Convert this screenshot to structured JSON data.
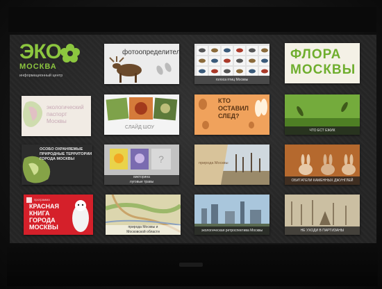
{
  "logo": {
    "main": "ЭКО",
    "city": "МОСКВА",
    "subtitle": "информационный центр"
  },
  "tiles": {
    "opredelitel": {
      "title": "фотоопределитель"
    },
    "birds": {
      "caption": "голоса птиц Москвы"
    },
    "flora": {
      "line1": "ФЛОРА",
      "line2": "МОСКВЫ"
    },
    "passport": {
      "line1": "экологический",
      "line2": "паспорт",
      "line3": "Москвы"
    },
    "slideshow": {
      "caption": "СЛАЙД ШОУ"
    },
    "tracks": {
      "line1": "КТО",
      "line2": "ОСТАВИЛ",
      "line3": "СЛЕД?"
    },
    "hedgehog": {
      "caption": "ЧТО ЕСТ ЕЖИК"
    },
    "protected": {
      "line1": "ОСОБО ОХРАНЯЕМЫЕ",
      "line2": "ПРИРОДНЫЕ ТЕРРИТОРИИ",
      "line3": "ГОРОДА МОСКВЫ"
    },
    "herbs": {
      "caption1": "викторина",
      "caption2": "луговые травы"
    },
    "nature": {
      "text": "природа Москвы"
    },
    "animals": {
      "caption": "ОБИТАТЕЛИ КАМЕННЫХ ДЖУНГЛЕЙ"
    },
    "redbook": {
      "pre": "программа",
      "line1": "КРАСНАЯ",
      "line2": "КНИГА",
      "line3": "ГОРОДА",
      "line4": "МОСКВЫ"
    },
    "map": {
      "caption1": "природа Москвы и",
      "caption2": "Московской области"
    },
    "retro": {
      "caption": "экологическая ретроспектива Москвы"
    },
    "park": {
      "caption": "НЕ УХОДИ В ПАРТИЗАНЫ"
    }
  },
  "colors": {
    "eco_green": "#8cc63f",
    "redbook_red": "#d5202a",
    "screen_bg": "#262626"
  }
}
